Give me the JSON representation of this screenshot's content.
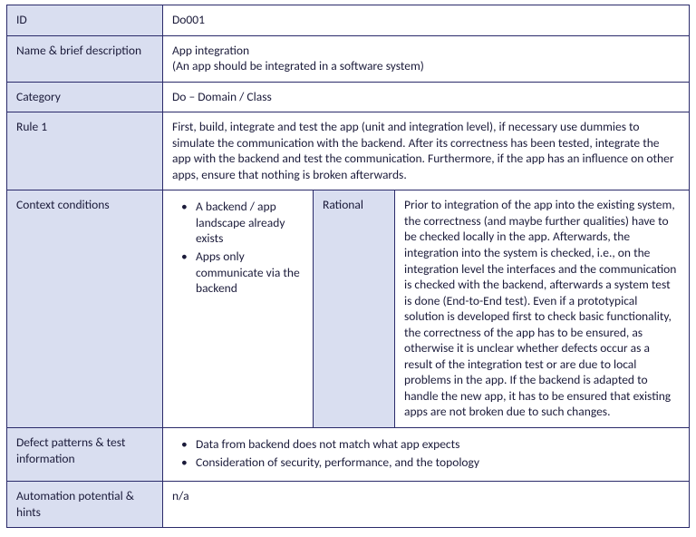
{
  "labels": {
    "id": "ID",
    "name": "Name & brief description",
    "category": "Category",
    "rule1": "Rule 1",
    "context": "Context conditions",
    "rational": "Rational",
    "defect": "Defect patterns & test information",
    "automation": "Automation potential & hints"
  },
  "values": {
    "id": "Do001",
    "name_main": "App integration",
    "name_sub": "(An app should be integrated in a software system)",
    "category": "Do – Domain / Class",
    "rule1": "First, build, integrate and test the app (unit and integration level), if necessary use dummies to simulate the communication with the backend. After its correctness has been tested, integrate the app with the backend and test the communication. Furthermore, if the app has an influence on other apps, ensure that nothing is broken afterwards.",
    "context_bullets": [
      "A backend / app landscape already exists",
      "Apps only communicate via the backend"
    ],
    "rational": "Prior to integration of the app into the existing system, the correctness (and maybe further qualities) have to be checked locally in the app. Afterwards, the integration into the system is checked, i.e., on the integration level the interfaces and the communication is checked with the backend, afterwards a system test is done (End-to-End test). Even if a prototypical solution is developed first to check basic functionality, the correctness of the app has to be ensured, as otherwise it is unclear whether defects occur as a result of the integration test or are due to local problems in the app. If the backend is adapted to handle the new app, it has to be ensured that existing apps are not broken due to such changes.",
    "defect_bullets": [
      "Data from backend does not match what app expects",
      "Consideration of security, performance, and the topology"
    ],
    "automation": "n/a"
  }
}
